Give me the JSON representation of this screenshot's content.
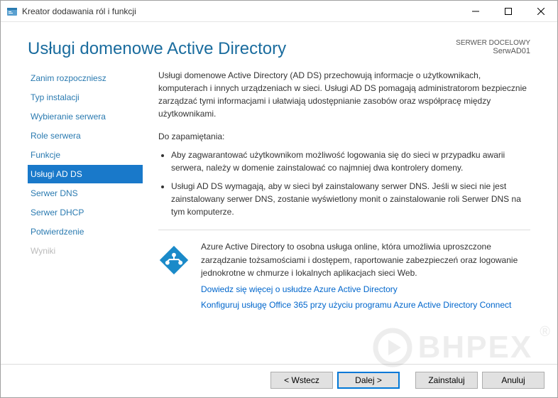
{
  "titlebar": {
    "text": "Kreator dodawania ról i funkcji"
  },
  "header": {
    "title": "Usługi domenowe Active Directory",
    "target_label": "SERWER DOCELOWY",
    "target_name": "SerwAD01"
  },
  "nav": {
    "items": [
      {
        "label": "Zanim rozpoczniesz",
        "state": "normal"
      },
      {
        "label": "Typ instalacji",
        "state": "normal"
      },
      {
        "label": "Wybieranie serwera",
        "state": "normal"
      },
      {
        "label": "Role serwera",
        "state": "normal"
      },
      {
        "label": "Funkcje",
        "state": "normal"
      },
      {
        "label": "Usługi AD DS",
        "state": "active"
      },
      {
        "label": "Serwer DNS",
        "state": "normal"
      },
      {
        "label": "Serwer DHCP",
        "state": "normal"
      },
      {
        "label": "Potwierdzenie",
        "state": "normal"
      },
      {
        "label": "Wyniki",
        "state": "disabled"
      }
    ]
  },
  "content": {
    "intro": "Usługi domenowe Active Directory (AD DS) przechowują informacje o użytkownikach, komputerach i innych urządzeniach w sieci. Usługi AD DS pomagają administratorom bezpiecznie zarządzać tymi informacjami i ułatwiają udostępnianie zasobów oraz współpracę między użytkownikami.",
    "remember_label": "Do zapamiętania:",
    "bullets": [
      "Aby zagwarantować użytkownikom możliwość logowania się do sieci w przypadku awarii serwera, należy w domenie zainstalować co najmniej dwa kontrolery domeny.",
      "Usługi AD DS wymagają, aby w sieci był zainstalowany serwer DNS. Jeśli w sieci nie jest zainstalowany serwer DNS, zostanie wyświetlony monit o zainstalowanie roli Serwer DNS na tym komputerze."
    ],
    "azure_info": "Azure Active Directory to osobna usługa online, która umożliwia uproszczone zarządzanie tożsamościami i dostępem, raportowanie zabezpieczeń oraz logowanie jednokrotne w chmurze i lokalnych aplikacjach sieci Web.",
    "link1": "Dowiedz się więcej o usłudze Azure Active Directory",
    "link2": "Konfiguruj usługę Office 365 przy użyciu programu Azure Active Directory Connect"
  },
  "footer": {
    "previous": "< Wstecz",
    "next": "Dalej >",
    "install": "Zainstaluj",
    "cancel": "Anuluj"
  },
  "icons": {
    "info_color": "#1a6c9e"
  },
  "watermark": {
    "text": "BHPEX",
    "reg": "®"
  }
}
